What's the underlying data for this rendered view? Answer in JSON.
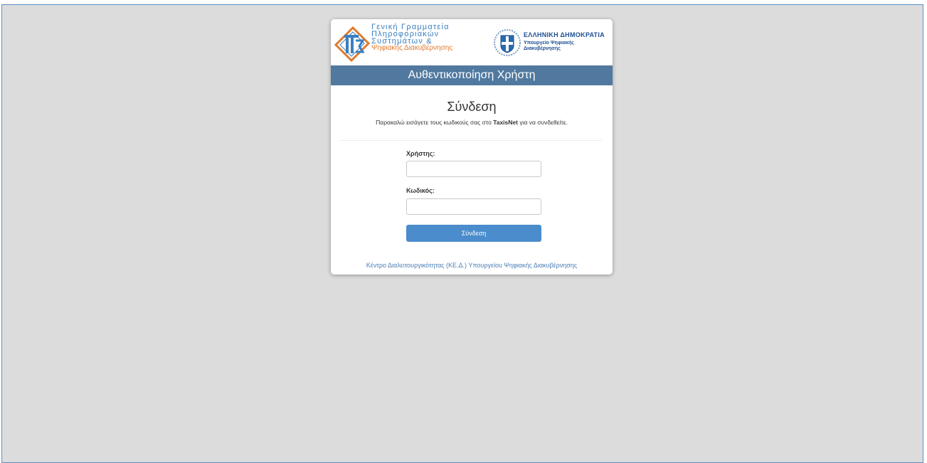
{
  "logos": {
    "gsis": {
      "line1": "Γενική Γραμματεία",
      "line2": "Πληροφοριακών",
      "line3": "Συστημάτων &",
      "line4": "Ψηφιακής Διακυβέρνησης",
      "icon": "gsis-logo-icon",
      "colors": {
        "blue": "#3a7fc1",
        "orange": "#e07a2c"
      }
    },
    "gov": {
      "title": "ΕΛΛΗΝΙΚΗ ΔΗΜΟΚΡΑΤΙΑ",
      "sub1": "Υπουργείο Ψηφιακής",
      "sub2": "Διακυβέρνησης",
      "icon": "greek-emblem-icon",
      "color": "#1d4f91"
    }
  },
  "header": {
    "title": "Αυθεντικοποίηση Χρήστη",
    "background": "#5179a0"
  },
  "login": {
    "title": "Σύνδεση",
    "instruction_pre": "Παρακαλώ εισάγετε τους κωδικούς σας στο ",
    "instruction_bold": "TaxisNet",
    "instruction_post": " για να συνδεθείτε.",
    "username_label": "Χρήστης:",
    "username_value": "",
    "password_label": "Κωδικός:",
    "password_value": "",
    "submit_label": "Σύνδεση",
    "button_color": "#4a8ccc"
  },
  "footer": {
    "link_text": "Κέντρο Διαλειτουργικότητας (ΚΕ.Δ.) Υπουργείου Ψηφιακής Διακυβέρνησης",
    "link_color": "#4a7db5"
  },
  "page": {
    "background": "#dcdcdc",
    "frame_border": "#5b8fc7"
  }
}
